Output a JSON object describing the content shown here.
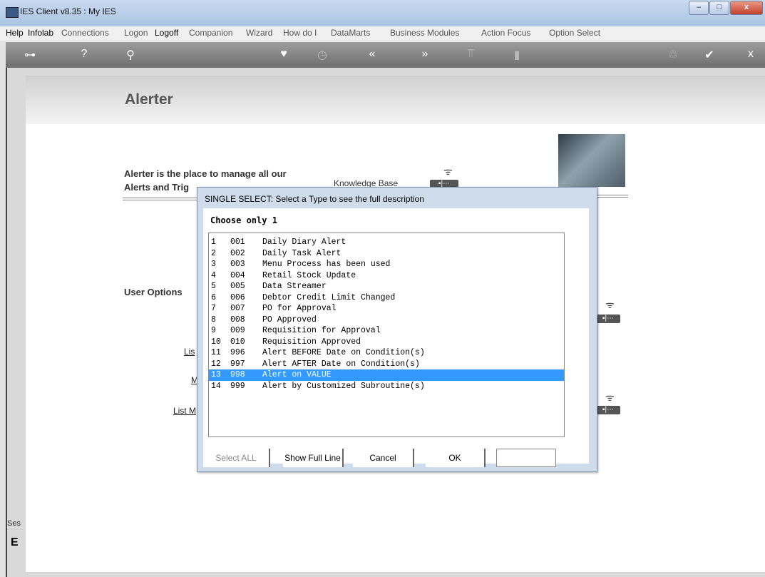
{
  "window": {
    "title": "IES Client v8.35 : My IES",
    "min": "–",
    "max": "□",
    "close": "x"
  },
  "menu": [
    "Help",
    "Infolab",
    "Connections",
    "Logon",
    "Logoff",
    "Companion",
    "Wizard",
    "How do I",
    "DataMarts",
    "Business Modules",
    "Action Focus",
    "Option Select"
  ],
  "toolbar": {
    "key": "⊶",
    "help": "?",
    "search": "⚲",
    "heart": "♥",
    "clock": "◷",
    "back": "«",
    "forward": "»",
    "tools": "⫪",
    "page": "▮",
    "recycle": "♲",
    "check": "✔",
    "close": "x"
  },
  "page": {
    "title": "Alerter",
    "intro_line1": "Alerter is the place to manage all our",
    "intro_line2": "Alerts and Trig",
    "kb_label": "Knowledge Base",
    "user_options": "User Options",
    "link1": "Lis",
    "link2": "M",
    "link3": "List M",
    "wifi": "ᯤ",
    "pill": "▪|⋯",
    "side_label": "Ses",
    "side_glyph": "E"
  },
  "dialog": {
    "title": "SINGLE SELECT: Select a Type to see the full description",
    "heading": "Choose only 1",
    "items": [
      {
        "n": "1",
        "code": "001",
        "desc": "Daily Diary Alert"
      },
      {
        "n": "2",
        "code": "002",
        "desc": "Daily Task Alert"
      },
      {
        "n": "3",
        "code": "003",
        "desc": "Menu Process has been used"
      },
      {
        "n": "4",
        "code": "004",
        "desc": "Retail Stock Update"
      },
      {
        "n": "5",
        "code": "005",
        "desc": "Data Streamer"
      },
      {
        "n": "6",
        "code": "006",
        "desc": "Debtor Credit Limit Changed"
      },
      {
        "n": "7",
        "code": "007",
        "desc": "PO for Approval"
      },
      {
        "n": "8",
        "code": "008",
        "desc": "PO Approved"
      },
      {
        "n": "9",
        "code": "009",
        "desc": "Requisition for Approval"
      },
      {
        "n": "10",
        "code": "010",
        "desc": "Requisition Approved"
      },
      {
        "n": "11",
        "code": "996",
        "desc": "Alert BEFORE Date on Condition(s)"
      },
      {
        "n": "12",
        "code": "997",
        "desc": "Alert AFTER Date on Condition(s)"
      },
      {
        "n": "13",
        "code": "998",
        "desc": "Alert on VALUE"
      },
      {
        "n": "14",
        "code": "999",
        "desc": "Alert by Customized Subroutine(s)"
      }
    ],
    "selected_index": 12,
    "buttons": {
      "select_all": "Select ALL",
      "show_full": "Show Full Line",
      "cancel": "Cancel",
      "ok": "OK"
    },
    "field_value": ""
  }
}
